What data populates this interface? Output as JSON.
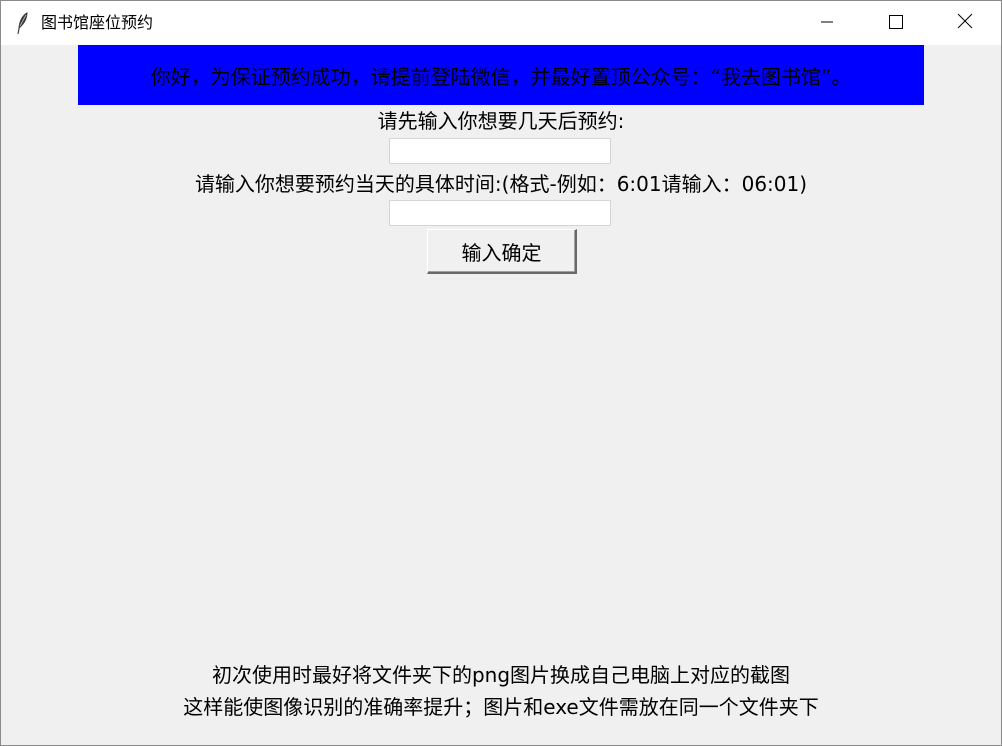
{
  "window": {
    "title": "图书馆座位预约",
    "icon": "feather-icon"
  },
  "banner": {
    "text": "你好，为保证预约成功，请提前登陆微信，并最好置顶公众号：“我去图书馆”。",
    "background_color": "#0000ff"
  },
  "form": {
    "days_label": "请先输入你想要几天后预约:",
    "days_value": "",
    "time_label": "请输入你想要预约当天的具体时间:(格式-例如：6:01请输入：06:01)",
    "time_value": "",
    "confirm_label": "输入确定"
  },
  "notes": {
    "line1": "初次使用时最好将文件夹下的png图片换成自己电脑上对应的截图",
    "line2": "这样能使图像识别的准确率提升；图片和exe文件需放在同一个文件夹下"
  }
}
